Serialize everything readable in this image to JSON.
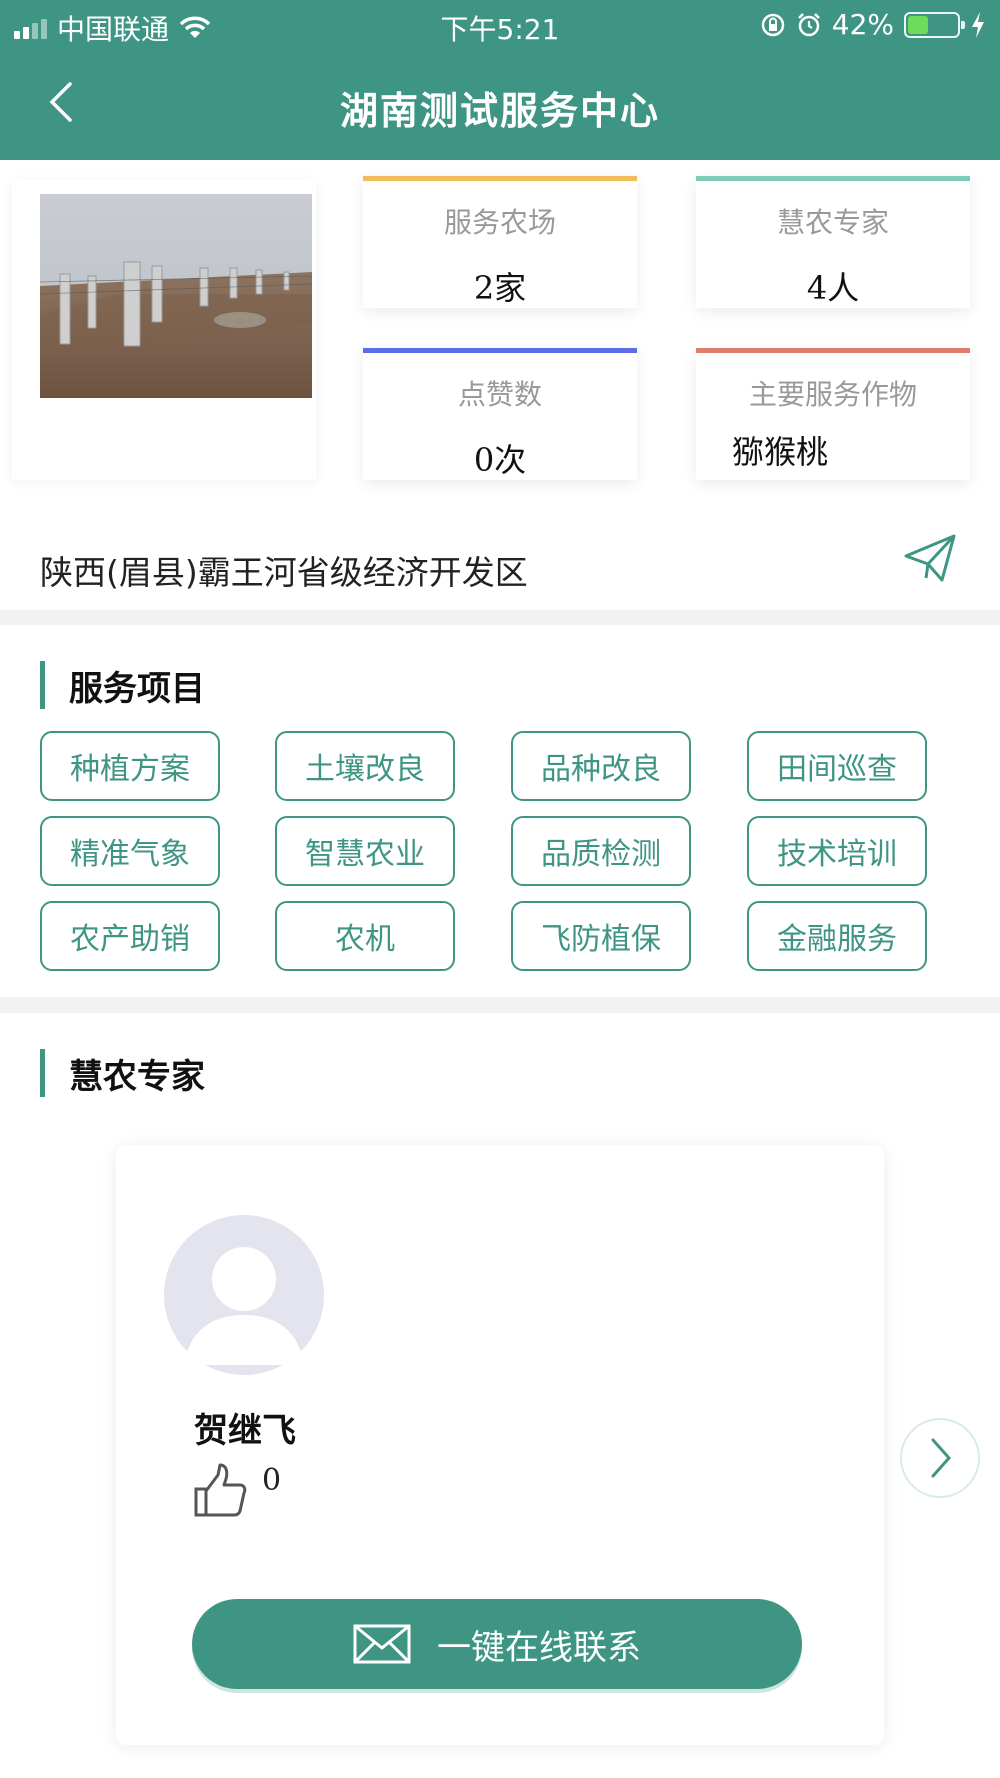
{
  "status_bar": {
    "carrier": "中国联通",
    "time": "下午5:21",
    "battery_percent": "42%",
    "battery_level": 0.42,
    "icons": [
      "signal-icon",
      "wifi-icon",
      "rotation-lock-icon",
      "alarm-icon",
      "battery-icon",
      "charging-icon"
    ]
  },
  "header": {
    "title": "湖南测试服务中心",
    "back_icon": "chevron-left-icon",
    "bg_color": "#3f9584"
  },
  "summary": {
    "farm_photo": "farm-field-photo",
    "stats": [
      {
        "label": "服务农场",
        "value": "2家",
        "accent": "#f0bd5b"
      },
      {
        "label": "慧农专家",
        "value": "4人",
        "accent": "#7fcbb9"
      },
      {
        "label": "点赞数",
        "value": "0次",
        "accent": "#5b6ee8"
      },
      {
        "label": "主要服务作物",
        "value": "猕猴桃",
        "accent": "#e07c6c"
      }
    ],
    "address": "陕西(眉县)霸王河省级经济开发区",
    "address_icon": "send-icon"
  },
  "services": {
    "title": "服务项目",
    "items": [
      "种植方案",
      "土壤改良",
      "品种改良",
      "田间巡查",
      "精准气象",
      "智慧农业",
      "品质检测",
      "技术培训",
      "农产助销",
      "农机",
      "飞防植保",
      "金融服务"
    ]
  },
  "experts": {
    "title": "慧农专家",
    "card": {
      "name": "贺继飞",
      "likes": "0",
      "avatar_icon": "default-avatar-icon",
      "like_icon": "thumbs-up-icon",
      "contact_label": "一键在线联系",
      "contact_icon": "mail-icon"
    },
    "next_icon": "chevron-right-icon"
  }
}
